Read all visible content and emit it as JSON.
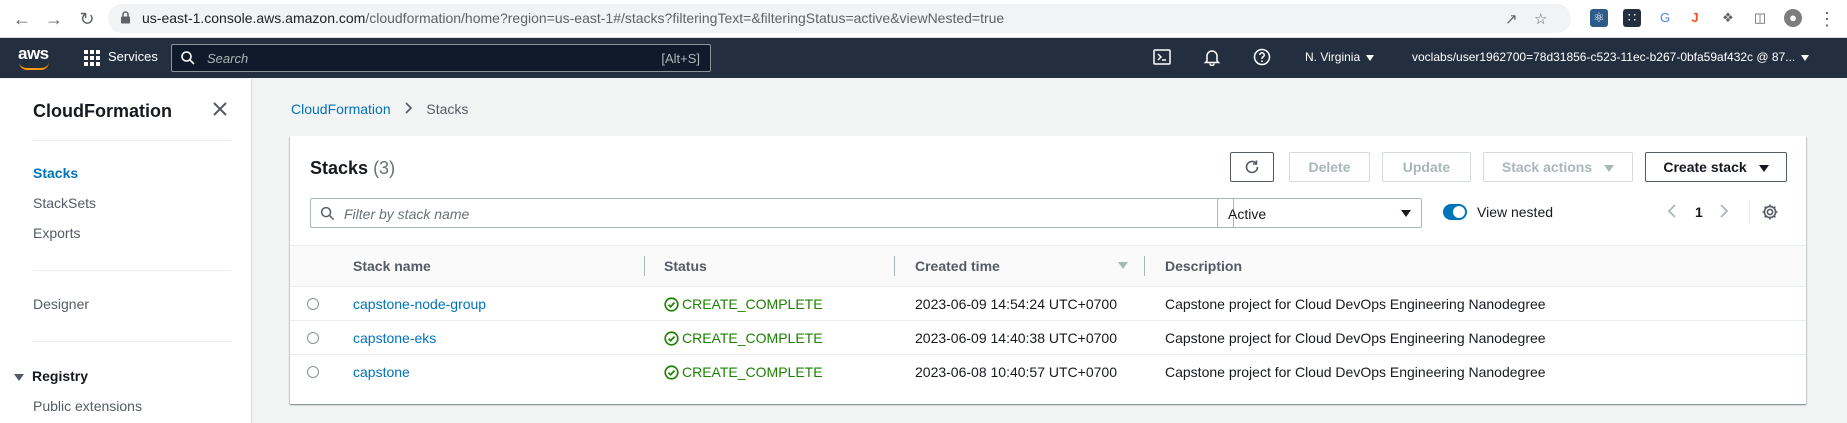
{
  "browser": {
    "url_host": "us-east-1.console.aws.amazon.com",
    "url_path": "/cloudformation/home?region=us-east-1#/stacks?filteringText=&filteringStatus=active&viewNested=true"
  },
  "topnav": {
    "services_label": "Services",
    "search_placeholder": "Search",
    "search_shortcut": "[Alt+S]",
    "region": "N. Virginia",
    "account": "voclabs/user1962700=78d31856-c523-11ec-b267-0bfa59af432c @ 87..."
  },
  "sidebar": {
    "title": "CloudFormation",
    "items": [
      {
        "label": "Stacks",
        "active": true
      },
      {
        "label": "StackSets"
      },
      {
        "label": "Exports"
      },
      {
        "label": "Designer"
      }
    ],
    "group": {
      "label": "Registry",
      "items": [
        {
          "label": "Public extensions"
        }
      ]
    }
  },
  "breadcrumb": {
    "parent": "CloudFormation",
    "current": "Stacks"
  },
  "stacks_panel": {
    "title": "Stacks",
    "count": "(3)",
    "buttons": {
      "delete": "Delete",
      "update": "Update",
      "stack_actions": "Stack actions",
      "create_stack": "Create stack"
    },
    "filter_placeholder": "Filter by stack name",
    "status_filter": "Active",
    "view_nested_label": "View nested",
    "view_nested_on": true,
    "page": "1",
    "columns": {
      "name": "Stack name",
      "status": "Status",
      "created": "Created time",
      "description": "Description"
    },
    "rows": [
      {
        "name": "capstone-node-group",
        "status": "CREATE_COMPLETE",
        "created": "2023-06-09 14:54:24 UTC+0700",
        "description": "Capstone project for Cloud DevOps Engineering Nanodegree"
      },
      {
        "name": "capstone-eks",
        "status": "CREATE_COMPLETE",
        "created": "2023-06-09 14:40:38 UTC+0700",
        "description": "Capstone project for Cloud DevOps Engineering Nanodegree"
      },
      {
        "name": "capstone",
        "status": "CREATE_COMPLETE",
        "created": "2023-06-08 10:40:57 UTC+0700",
        "description": "Capstone project for Cloud DevOps Engineering Nanodegree"
      }
    ]
  },
  "colors": {
    "link": "#0073bb",
    "success": "#1d8102",
    "topnav_bg": "#232f3e",
    "aws_orange": "#ff9900"
  }
}
